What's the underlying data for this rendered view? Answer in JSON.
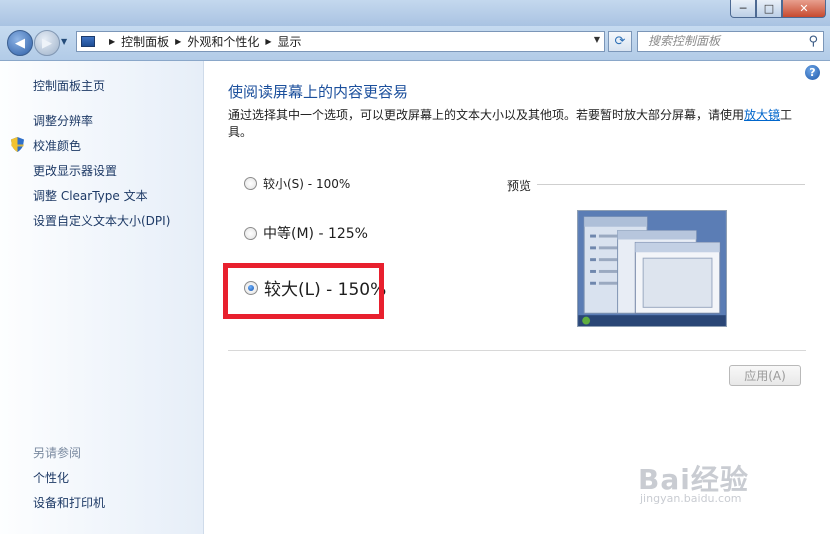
{
  "window": {
    "controls": {
      "minimize_glyph": "─",
      "maximize_glyph": "□",
      "close_glyph": "✕"
    }
  },
  "nav": {
    "back_icon": "back-arrow-icon",
    "forward_icon": "forward-arrow-icon",
    "breadcrumb": [
      "控制面板",
      "外观和个性化",
      "显示"
    ],
    "search_placeholder": "搜索控制面板"
  },
  "sidebar": {
    "home": "控制面板主页",
    "links": [
      "调整分辨率",
      "校准颜色",
      "更改显示器设置",
      "调整 ClearType 文本",
      "设置自定义文本大小(DPI)"
    ],
    "see_also_title": "另请参阅",
    "see_also": [
      "个性化",
      "设备和打印机"
    ]
  },
  "main": {
    "title": "使阅读屏幕上的内容更容易",
    "description_before": "通过选择其中一个选项，可以更改屏幕上的文本大小以及其他项。若要暂时放大部分屏幕，请使用",
    "description_link": "放大镜",
    "description_after": "工具。",
    "options": [
      {
        "label": "较小(S) - 100%",
        "selected": false
      },
      {
        "label": "中等(M) - 125%",
        "selected": false
      },
      {
        "label": "较大(L) - 150%",
        "selected": true
      }
    ],
    "preview_label": "预览",
    "apply_button": "应用(A)"
  },
  "watermark": {
    "brand": "Bai经验",
    "url": "jingyan.baidu.com"
  },
  "colors": {
    "link": "#1b4f9c",
    "highlight": "#e8202e"
  }
}
